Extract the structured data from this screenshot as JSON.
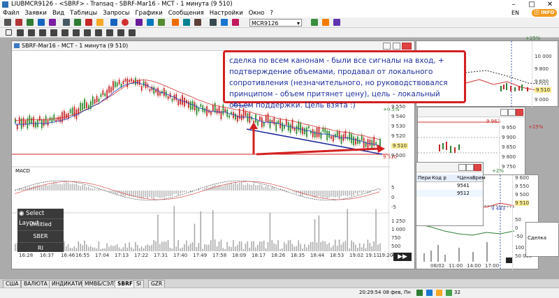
{
  "window": {
    "title": "LIUBMCR9126 - <SBRF> - Transaq - SBRF-Mar16 - MCT - 1 минута (9 510)",
    "lang": "EN",
    "info_label": "INFO"
  },
  "menu": [
    "Файл",
    "Заявки",
    "Вид",
    "Таблицы",
    "Запросы",
    "Графики",
    "Сообщения",
    "Настройки",
    "Окно",
    "?"
  ],
  "toolbar": {
    "ticker": "MCR9126"
  },
  "main_chart": {
    "title": "SBRF-Mar16 - MCT - 1 минута (9 510)",
    "pct_label": "+0.5%",
    "price_ticks": [
      "9 550",
      "9 540",
      "9 530",
      "9 520",
      "9 510",
      "9 500"
    ],
    "last_price": "9 510",
    "line_price": "9 510",
    "macd_label": "MACD",
    "macd_ticks": [
      "5",
      "0",
      "-5"
    ],
    "volume_ticks": [
      "1 250",
      "1 000",
      "750",
      "500",
      "250"
    ],
    "time_ticks": [
      "16:55",
      "17:04",
      "17:13",
      "17:22",
      "17:31",
      "17:40",
      "17:49",
      "17:58",
      "18:09",
      "18:17",
      "18:26",
      "18:35",
      "18:44",
      "18:53",
      "19:02",
      "19:11",
      "19:20"
    ],
    "time_ticks_partial": [
      "16:28",
      "16:37",
      "16:46"
    ]
  },
  "callout": {
    "text": "сделка по всем канонам - были все сигналы на вход, + подтверждение объемами, продавал от локального сопротивления (незначительного, но руководствовался принципом - объем притянет цену), цель - локальный объем поддержки. Цель взята :)"
  },
  "right_chart_a": {
    "pct": "+25%",
    "ticks": [
      "10 000",
      "9 800",
      "9 600",
      "9 510",
      "9 400",
      "9 200",
      "9 000"
    ],
    "last": "9 510"
  },
  "right_chart_b": {
    "pct": "+25%",
    "price_box": "9 963",
    "ticks": [
      "9 950",
      "9 900",
      "9 850",
      "9 800",
      "9 750",
      "9 700"
    ]
  },
  "right_chart_c": {
    "pct": "+2%",
    "ticks": [
      "9 600",
      "9 550",
      "9 500",
      "9 483",
      "9 510",
      "50",
      "0",
      "-50",
      "100 000",
      "50 000"
    ],
    "xticks": [
      "08/02",
      "11:00",
      "14:00",
      "17:00"
    ]
  },
  "quotes_table": {
    "headers": [
      "Пери",
      "Код р",
      "*Цена",
      "Врем"
    ],
    "rows": [
      [
        "",
        "",
        "9541",
        ""
      ],
      [
        "",
        "",
        "9512",
        ""
      ]
    ]
  },
  "partial_window": {
    "text": "Сделка"
  },
  "layout_panel": {
    "title": "Select Layout",
    "items": [
      "Untitled",
      "SBER",
      "RI"
    ]
  },
  "tabs": [
    "США",
    "ВАЛЮТА",
    "ИНДИКАТИВ",
    "ММВБ/СЭЛТ",
    "SBRF",
    "SI",
    "GZR"
  ],
  "status": {
    "time": "20:29:54",
    "date": "08 фев, Пн",
    "signal": "32"
  }
}
